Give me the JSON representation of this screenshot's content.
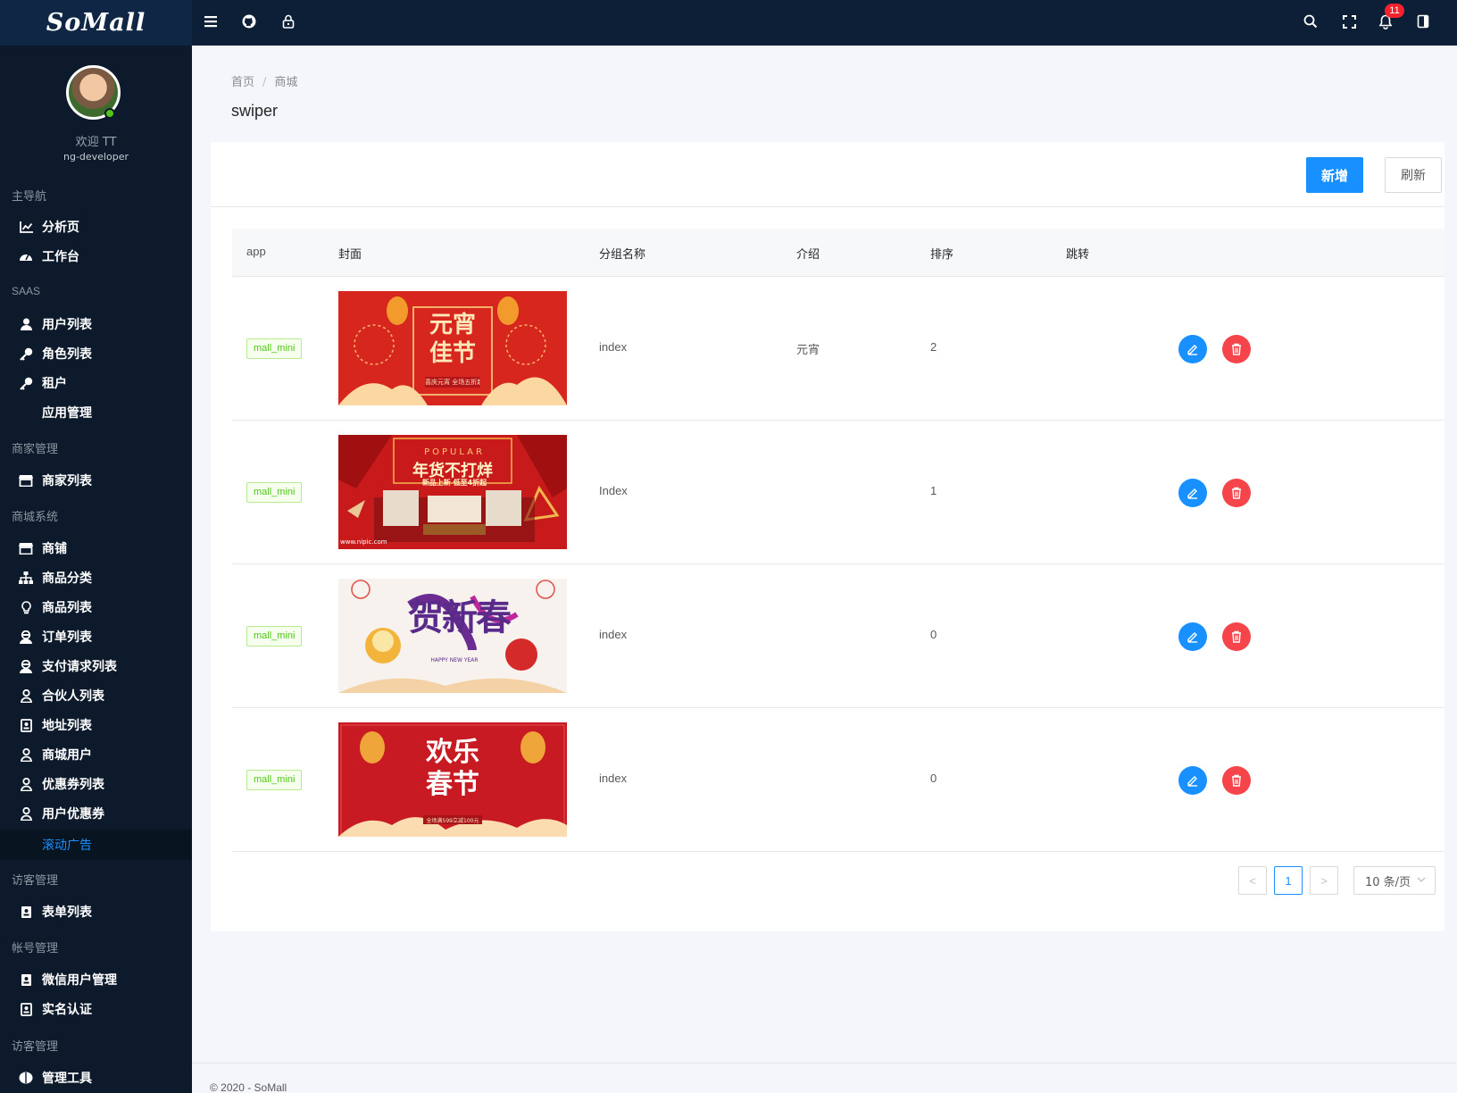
{
  "app": {
    "logo": "SoMall"
  },
  "header": {
    "notification_count": "11"
  },
  "user": {
    "welcome": "欢迎 TT",
    "role": "ng-developer"
  },
  "sidebar": {
    "groups": [
      "主导航",
      "SAAS",
      "商家管理",
      "商城系统",
      "访客管理",
      "帐号管理",
      "访客管理"
    ],
    "items": [
      {
        "label": "分析页",
        "icon": "chart-line-icon"
      },
      {
        "label": "工作台",
        "icon": "dashboard-icon"
      },
      {
        "label": "用户列表",
        "icon": "user-icon"
      },
      {
        "label": "角色列表",
        "icon": "key-icon"
      },
      {
        "label": "租户",
        "icon": "key-icon"
      },
      {
        "label": "应用管理",
        "icon": ""
      },
      {
        "label": "商家列表",
        "icon": "store-icon"
      },
      {
        "label": "商铺",
        "icon": "store-icon"
      },
      {
        "label": "商品分类",
        "icon": "sitemap-icon"
      },
      {
        "label": "商品列表",
        "icon": "bulb-icon"
      },
      {
        "label": "订单列表",
        "icon": "user-secret-icon"
      },
      {
        "label": "支付请求列表",
        "icon": "user-secret-icon"
      },
      {
        "label": "合伙人列表",
        "icon": "user-outline-icon"
      },
      {
        "label": "地址列表",
        "icon": "contact-card-icon"
      },
      {
        "label": "商城用户",
        "icon": "user-outline-icon"
      },
      {
        "label": "优惠券列表",
        "icon": "user-outline-icon"
      },
      {
        "label": "用户优惠券",
        "icon": "user-outline-icon"
      },
      {
        "label": "滚动广告",
        "icon": ""
      },
      {
        "label": "表单列表",
        "icon": "contact-card-icon"
      },
      {
        "label": "微信用户管理",
        "icon": "contact-card-icon"
      },
      {
        "label": "实名认证",
        "icon": "contact-card-icon"
      },
      {
        "label": "管理工具",
        "icon": "brain-icon"
      }
    ],
    "active_item": "滚动广告"
  },
  "breadcrumb": {
    "home": "首页",
    "current": "商城",
    "separator": "/"
  },
  "page": {
    "title": "swiper"
  },
  "toolbar": {
    "add_label": "新增",
    "refresh_label": "刷新"
  },
  "table": {
    "headers": {
      "app": "app",
      "cover": "封面",
      "group": "分组名称",
      "intro": "介绍",
      "sort": "排序",
      "jump": "跳转"
    },
    "rows": [
      {
        "app": "mall_mini",
        "cover": "lantern-festival-banner",
        "cover_text": "元宵佳节",
        "cover_sub": "喜庆元宵 全场五折起",
        "group": "index",
        "intro": "元宵",
        "sort": "2"
      },
      {
        "app": "mall_mini",
        "cover": "new-year-goods-banner",
        "cover_text": "年货不打烊",
        "cover_top": "POPULAR",
        "cover_sub": "新品上新 低至4折起",
        "cover_foot": "www.nipic.com",
        "group": "Index",
        "intro": "",
        "sort": "1"
      },
      {
        "app": "mall_mini",
        "cover": "spring-greeting-banner",
        "cover_text": "贺新春",
        "cover_sub": "HAPPY NEW YEAR",
        "group": "index",
        "intro": "",
        "sort": "0"
      },
      {
        "app": "mall_mini",
        "cover": "happy-spring-festival-banner",
        "cover_text": "欢乐春节",
        "cover_sub": "全场满599立减100元",
        "group": "index",
        "intro": "",
        "sort": "0"
      }
    ]
  },
  "pagination": {
    "current_page": "1",
    "page_size": "10 条/页",
    "prev": "<",
    "next": ">"
  },
  "footer": {
    "text": "© 2020 - SoMall"
  }
}
